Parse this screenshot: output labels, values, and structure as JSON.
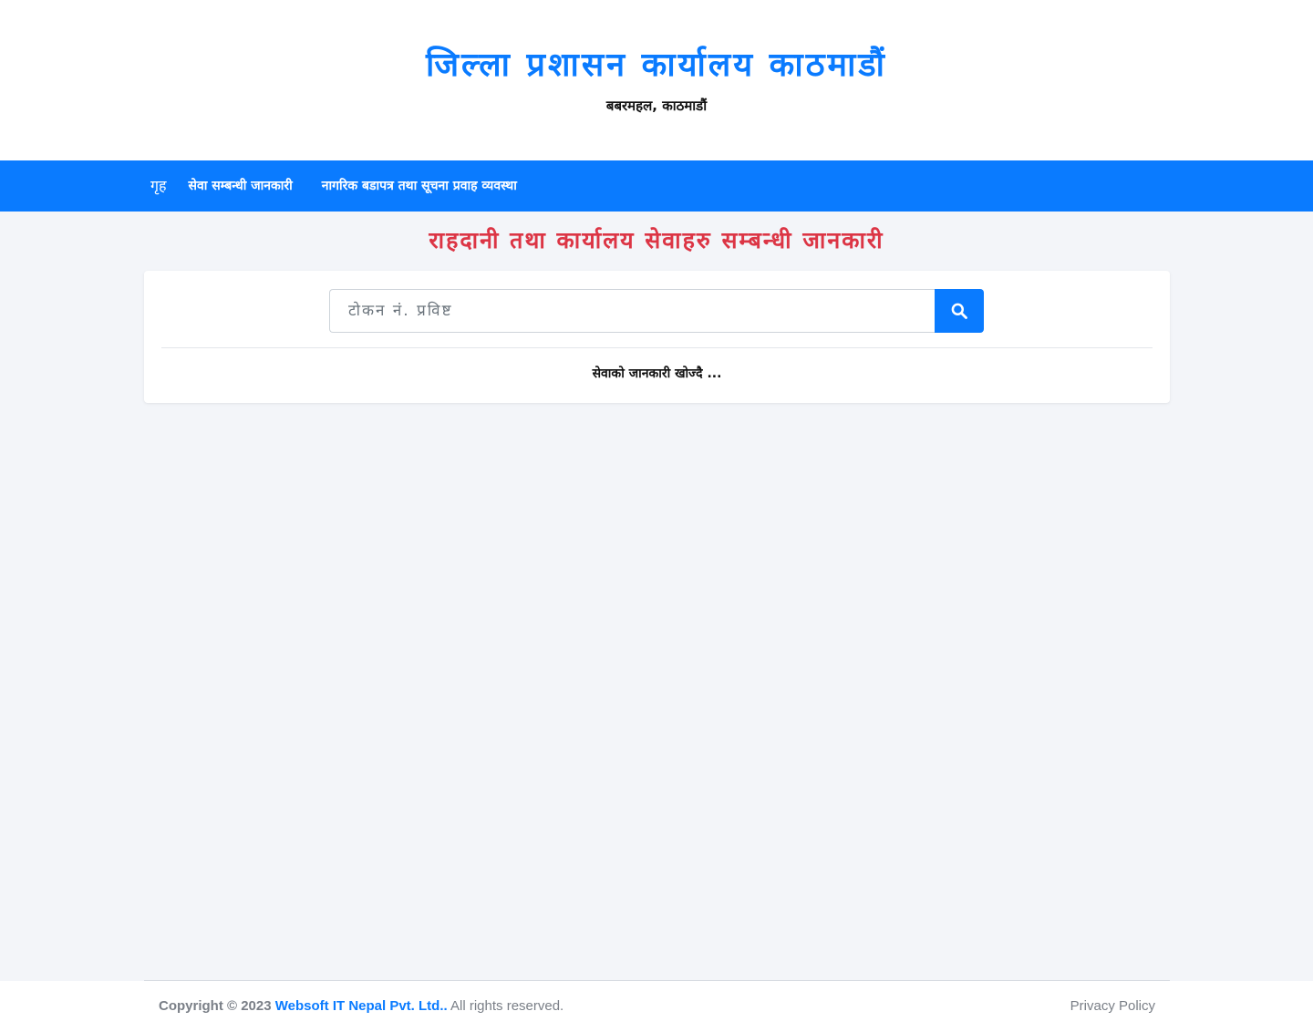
{
  "header": {
    "title": "जिल्ला प्रशासन कार्यालय काठमाडौं",
    "subtitle": "बबरमहल, काठमाडौं"
  },
  "nav": {
    "home_label": "गृह",
    "items": [
      {
        "label": "सेवा सम्बन्धी जानकारी"
      },
      {
        "label": "नागरिक बडापत्र तथा सूचना प्रवाह व्यवस्था"
      }
    ]
  },
  "main": {
    "heading": "राहदानी तथा कार्यालय सेवाहरु सम्बन्धी जानकारी",
    "search": {
      "placeholder": "टोकन नं. प्रविष्ट",
      "button_icon": "search-icon"
    },
    "status_text": "सेवाको जानकारी खोज्दै ..."
  },
  "footer": {
    "copyright": "Copyright © 2023",
    "company": "Websoft IT Nepal Pvt. Ltd.",
    "dot": ".",
    "rights": "All rights reserved.",
    "privacy": "Privacy Policy"
  },
  "colors": {
    "primary": "#0a7bff",
    "heading_red": "#dc3545",
    "background": "#f3f5f9"
  }
}
